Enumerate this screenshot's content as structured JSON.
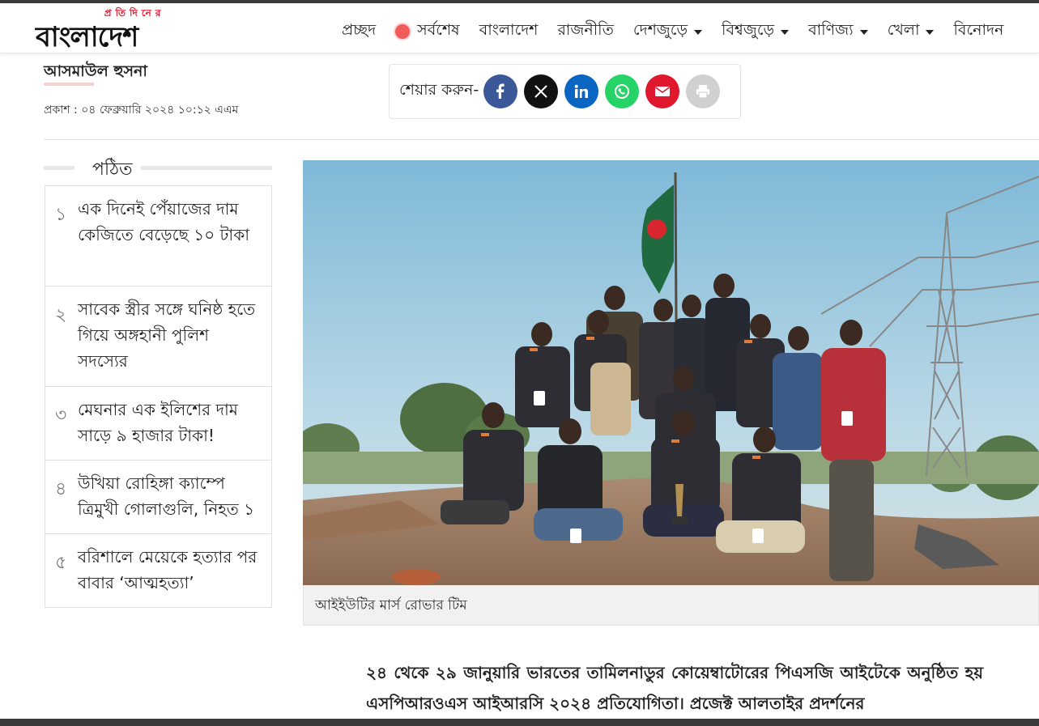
{
  "site": {
    "logo_tagline": "প্রতিদিনের",
    "logo_main": "বাংলাদেশ"
  },
  "nav": {
    "items": [
      {
        "label": "প্রচ্ছদ",
        "has_dropdown": false
      },
      {
        "label": "সর্বশেষ",
        "has_dropdown": false,
        "live": true
      },
      {
        "label": "বাংলাদেশ",
        "has_dropdown": false
      },
      {
        "label": "রাজনীতি",
        "has_dropdown": false
      },
      {
        "label": "দেশজুড়ে",
        "has_dropdown": true
      },
      {
        "label": "বিশ্বজুড়ে",
        "has_dropdown": true
      },
      {
        "label": "বাণিজ্য",
        "has_dropdown": true
      },
      {
        "label": "খেলা",
        "has_dropdown": true
      },
      {
        "label": "বিনোদন",
        "has_dropdown": false
      }
    ],
    "live_color": "#f25b5b"
  },
  "article_meta": {
    "author": "আসমাউল হুসনা",
    "published": "প্রকাশ : ০৪ ফেব্রুয়ারি ২০২৪ ১০:১২ এএম"
  },
  "share": {
    "label": "শেয়ার করুন-",
    "buttons": [
      {
        "name": "facebook",
        "icon": "facebook-icon",
        "color": "#3b5998"
      },
      {
        "name": "x",
        "icon": "x-icon",
        "color": "#111111"
      },
      {
        "name": "linkedin",
        "icon": "linkedin-icon",
        "color": "#0a66c2"
      },
      {
        "name": "whatsapp",
        "icon": "whatsapp-icon",
        "color": "#25d366"
      },
      {
        "name": "email",
        "icon": "email-icon",
        "color": "#e0182d"
      },
      {
        "name": "print",
        "icon": "print-icon",
        "color": "#cfcfcf"
      }
    ]
  },
  "sidebar": {
    "title": "পঠিত",
    "items": [
      {
        "num": "১",
        "text": "এক দিনেই পেঁয়াজের দাম কেজিতে বেড়েছে ১০ টাকা"
      },
      {
        "num": "২",
        "text": "সাবেক স্ত্রীর সঙ্গে ঘনিষ্ঠ হতে গিয়ে অঙ্গহানী পুলিশ সদস্যের"
      },
      {
        "num": "৩",
        "text": "মেঘনার এক ইলিশের দাম সাড়ে ৯ হাজার টাকা!"
      },
      {
        "num": "৪",
        "text": "উখিয়া রোহিঙ্গা ক্যাম্পে ত্রিমুখী গোলাগুলি, নিহত ১"
      },
      {
        "num": "৫",
        "text": "বরিশালে মেয়েকে হত্যার পর বাবার ‘আত্মহত্যা’"
      }
    ]
  },
  "photo": {
    "caption": "আইইউটির মার্স রোভার টিম"
  },
  "article": {
    "paragraph": "২৪ থেকে ২৯ জানুয়ারি  ভারতের তামিলনাডুর কোয়েম্বাটোরের পিএসজি আইটেকে অনুষ্ঠিত হয় এসপিআরওএস আইআরসি ২০২৪ প্রতিযোগিতা। প্রজেক্ট আলতাইর প্রদর্শনের"
  }
}
